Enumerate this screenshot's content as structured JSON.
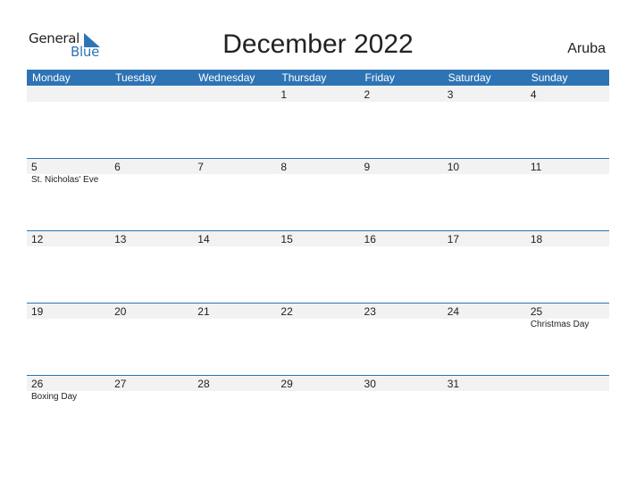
{
  "logo": {
    "text1": "General",
    "text2": "Blue"
  },
  "title": "December 2022",
  "country": "Aruba",
  "accent_color": "#2e74b5",
  "weekdays": [
    "Monday",
    "Tuesday",
    "Wednesday",
    "Thursday",
    "Friday",
    "Saturday",
    "Sunday"
  ],
  "weeks": [
    [
      {
        "d": ""
      },
      {
        "d": ""
      },
      {
        "d": ""
      },
      {
        "d": "1"
      },
      {
        "d": "2"
      },
      {
        "d": "3"
      },
      {
        "d": "4"
      }
    ],
    [
      {
        "d": "5",
        "h": "St. Nicholas' Eve"
      },
      {
        "d": "6"
      },
      {
        "d": "7"
      },
      {
        "d": "8"
      },
      {
        "d": "9"
      },
      {
        "d": "10"
      },
      {
        "d": "11"
      }
    ],
    [
      {
        "d": "12"
      },
      {
        "d": "13"
      },
      {
        "d": "14"
      },
      {
        "d": "15"
      },
      {
        "d": "16"
      },
      {
        "d": "17"
      },
      {
        "d": "18"
      }
    ],
    [
      {
        "d": "19"
      },
      {
        "d": "20"
      },
      {
        "d": "21"
      },
      {
        "d": "22"
      },
      {
        "d": "23"
      },
      {
        "d": "24"
      },
      {
        "d": "25",
        "h": "Christmas Day"
      }
    ],
    [
      {
        "d": "26",
        "h": "Boxing Day"
      },
      {
        "d": "27"
      },
      {
        "d": "28"
      },
      {
        "d": "29"
      },
      {
        "d": "30"
      },
      {
        "d": "31"
      },
      {
        "d": ""
      }
    ]
  ]
}
